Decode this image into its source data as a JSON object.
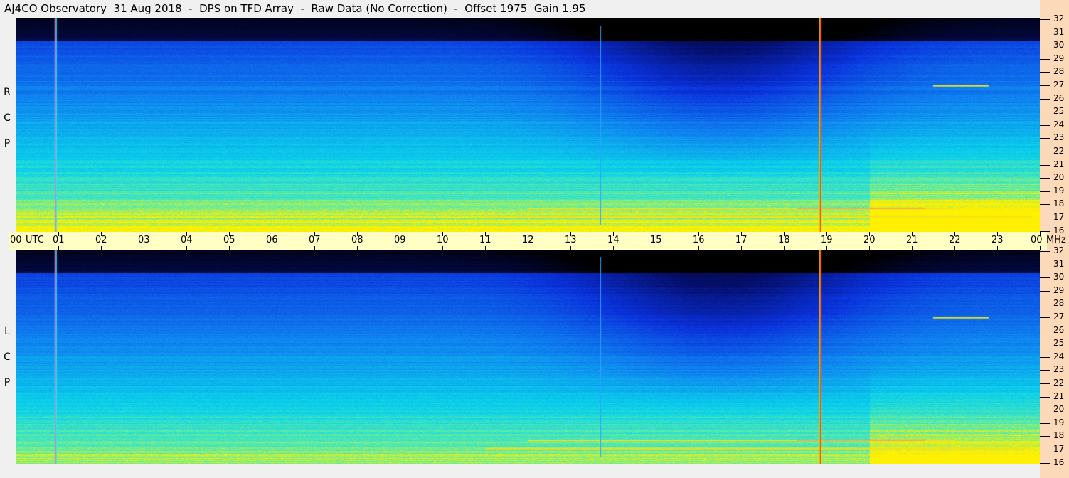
{
  "title": "AJ4CO Observatory  31 Aug 2018  -  DPS on TFD Array  -  Raw Data (No Correction)  -  Offset 1975  Gain 1.95",
  "panels": [
    {
      "label": [
        "R",
        "C",
        "P"
      ]
    },
    {
      "label": [
        "L",
        "C",
        "P"
      ]
    }
  ],
  "chart_data": {
    "type": "heatmap",
    "title": "AJ4CO Observatory  31 Aug 2018  -  DPS on TFD Array  -  Raw Data (No Correction)  -  Offset 1975  Gain 1.95",
    "xlabel": "UTC",
    "ylabel": "MHz",
    "x_ticks": [
      "00",
      "01",
      "02",
      "03",
      "04",
      "05",
      "06",
      "07",
      "08",
      "09",
      "10",
      "11",
      "12",
      "13",
      "14",
      "15",
      "16",
      "17",
      "18",
      "19",
      "20",
      "21",
      "22",
      "23",
      "00"
    ],
    "y_ticks": [
      "32",
      "31",
      "30",
      "29",
      "28",
      "27",
      "26",
      "25",
      "24",
      "23",
      "22",
      "21",
      "20",
      "19",
      "18",
      "17",
      "16"
    ],
    "xlim": [
      0,
      24
    ],
    "ylim": [
      16,
      32
    ],
    "utc_label": "UTC",
    "unit_label": "MHz",
    "series": [
      "RCP",
      "LCP"
    ],
    "features": {
      "vertical_lines_utc": [
        0.93,
        18.85
      ],
      "band_lines_mhz": [
        27,
        17.8,
        17.2
      ]
    }
  }
}
